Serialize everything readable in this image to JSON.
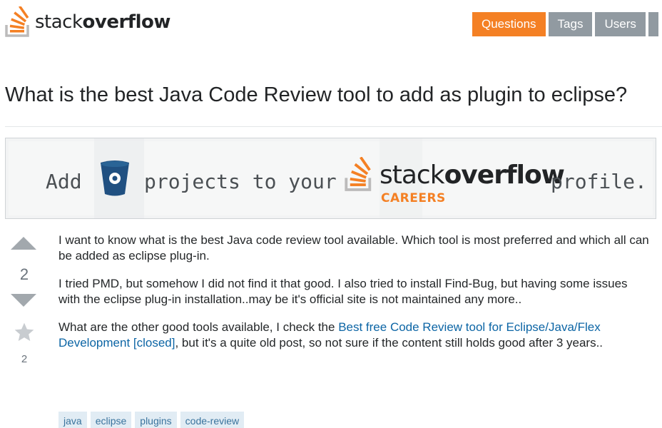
{
  "header": {
    "logo_light": "stack",
    "logo_bold": "overflow",
    "nav": [
      {
        "label": "Questions",
        "active": true
      },
      {
        "label": "Tags",
        "active": false
      },
      {
        "label": "Users",
        "active": false
      }
    ]
  },
  "question": {
    "title": "What is the best Java Code Review tool to add as plugin to eclipse?"
  },
  "banner": {
    "word_add": "Add",
    "word_projects": "projects to your",
    "brand_light": "stack",
    "brand_bold": "overflow",
    "brand_sub": "CAREERS",
    "word_profile": "profile."
  },
  "vote": {
    "score": "2",
    "favorites": "2"
  },
  "post": {
    "p1": "I want to know what is the best Java code review tool available. Which tool is most preferred and which all can be added as eclipse plug-in.",
    "p2": "I tried PMD, but somehow I did not find it that good. I also tried to install Find-Bug, but having some issues with the eclipse plug-in installation..may be it's official site is not maintained any more..",
    "p3_before": "What are the other good tools available, I check the ",
    "p3_link": "Best free Code Review tool for Eclipse/Java/Flex Development [closed]",
    "p3_after": ", but it's a quite old post, so not sure if the content still holds good after 3 years.."
  },
  "tags": [
    "java",
    "eclipse",
    "plugins",
    "code-review"
  ],
  "colors": {
    "accent": "#f48024",
    "nav_inactive": "#919aa1",
    "link": "#0c65a5",
    "tag_bg": "#e1ecf4",
    "tag_text": "#39739d",
    "bitbucket_blue": "#205081"
  }
}
